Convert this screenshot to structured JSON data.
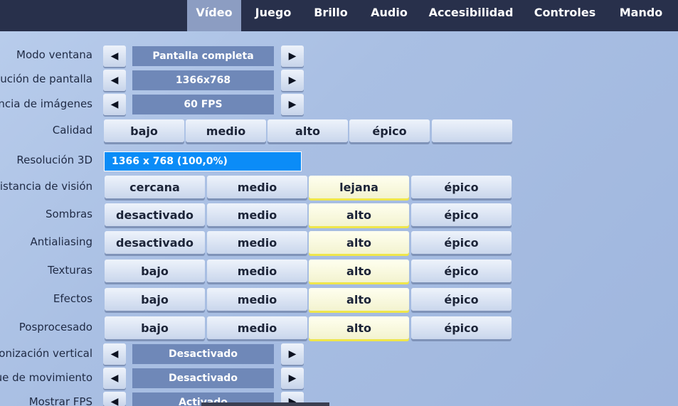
{
  "tabs": [
    {
      "label": "Vídeo",
      "active": true
    },
    {
      "label": "Juego"
    },
    {
      "label": "Brillo"
    },
    {
      "label": "Audio"
    },
    {
      "label": "Accesibilidad"
    },
    {
      "label": "Controles"
    },
    {
      "label": "Mando"
    }
  ],
  "settings": {
    "window_mode": {
      "label": "Modo ventana",
      "value": "Pantalla completa"
    },
    "resolution": {
      "label": "olución de pantalla",
      "value": "1366x768"
    },
    "frame_rate": {
      "label": "ncia de imágenes",
      "value": "60 FPS"
    },
    "quality": {
      "label": "Calidad",
      "options": [
        "bajo",
        "medio",
        "alto",
        "épico",
        ""
      ]
    },
    "res3d": {
      "label": "Resolución 3D",
      "value": "1366 x 768 (100,0%)",
      "fill_percent": 100
    },
    "view_distance": {
      "label": "Distancia de visión",
      "options": [
        "cercana",
        "medio",
        "lejana",
        "épico"
      ],
      "selected": "lejana"
    },
    "shadows": {
      "label": "Sombras",
      "options": [
        "desactivado",
        "medio",
        "alto",
        "épico"
      ],
      "selected": "alto"
    },
    "antialiasing": {
      "label": "Antialiasing",
      "options": [
        "desactivado",
        "medio",
        "alto",
        "épico"
      ],
      "selected": "alto"
    },
    "textures": {
      "label": "Texturas",
      "options": [
        "bajo",
        "medio",
        "alto",
        "épico"
      ],
      "selected": "alto"
    },
    "effects": {
      "label": "Efectos",
      "options": [
        "bajo",
        "medio",
        "alto",
        "épico"
      ],
      "selected": "alto"
    },
    "postprocessing": {
      "label": "Posprocesado",
      "options": [
        "bajo",
        "medio",
        "alto",
        "épico"
      ],
      "selected": "alto"
    },
    "vsync": {
      "label": "ronización vertical",
      "value": "Desactivado"
    },
    "motion_blur": {
      "label": "ue de movimiento",
      "value": "Desactivado"
    },
    "show_fps": {
      "label": "Mostrar FPS",
      "value": "Activado"
    }
  },
  "icons": {
    "left": "◀",
    "right": "▶"
  },
  "colors": {
    "topbar": "#28304b",
    "active_tab": "#8c9dc2",
    "res3d_fill": "#0b8cf7",
    "selected_underline": "#efe64b"
  }
}
